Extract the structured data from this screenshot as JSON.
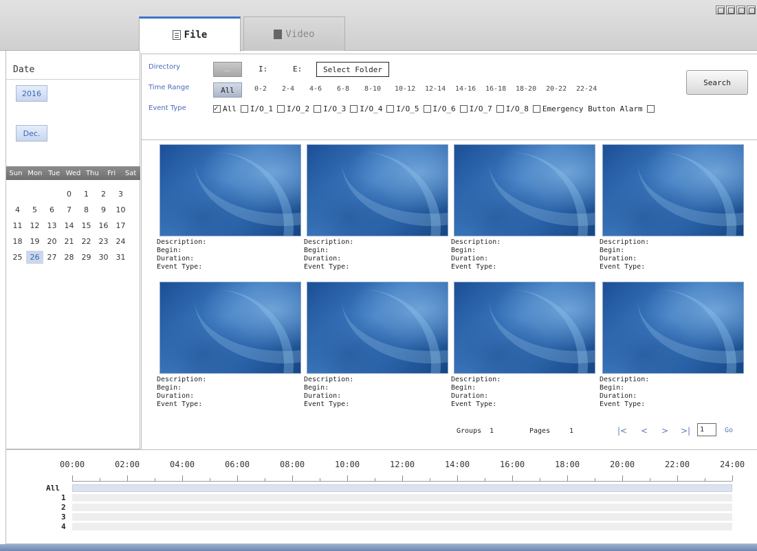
{
  "tabs": [
    {
      "label": "File",
      "icon": "file-icon",
      "active": true
    },
    {
      "label": "Video",
      "icon": "video-icon",
      "active": false
    }
  ],
  "window_buttons": [
    "restore-icon",
    "minimize-icon",
    "maximize-icon",
    "close-icon"
  ],
  "date_panel": {
    "label": "Date",
    "year": "2016",
    "month": "Dec.",
    "weekdays": [
      "Sun",
      "Mon",
      "Tue",
      "Wed",
      "Thu",
      "Fri",
      "Sat"
    ],
    "days": [
      "",
      "",
      "",
      "0",
      "1",
      "2",
      "3",
      "4",
      "5",
      "6",
      "7",
      "8",
      "9",
      "10",
      "11",
      "12",
      "13",
      "14",
      "15",
      "16",
      "17",
      "18",
      "19",
      "20",
      "21",
      "22",
      "23",
      "24",
      "25",
      "26",
      "27",
      "28",
      "29",
      "30",
      "31"
    ],
    "selected_day": "26",
    "accent_color": "#3a66b5"
  },
  "search_panel": {
    "directory_label": "Directory",
    "time_range_label": "Time Range",
    "event_type_label": "Event Type",
    "directory_button": "...",
    "drives": [
      "I:",
      "E:"
    ],
    "select_folder": "Select Folder",
    "all_button": "All",
    "time_ranges": [
      "0-2",
      "2-4",
      "4-6",
      "6-8",
      "8-10",
      "10-12",
      "12-14",
      "14-16",
      "16-18",
      "18-20",
      "20-22",
      "22-24"
    ],
    "event_types": [
      {
        "label": "All",
        "checked": true
      },
      {
        "label": "I/O_1",
        "checked": false
      },
      {
        "label": "I/O_2",
        "checked": false
      },
      {
        "label": "I/O_3",
        "checked": false
      },
      {
        "label": "I/O_4",
        "checked": false
      },
      {
        "label": "I/O_5",
        "checked": false
      },
      {
        "label": "I/O_6",
        "checked": false
      },
      {
        "label": "I/O_7",
        "checked": false
      },
      {
        "label": "I/O_8",
        "checked": false
      },
      {
        "label": "Emergency Button Alarm",
        "checked": false
      }
    ],
    "search_button": "Search"
  },
  "results": {
    "meta_labels": [
      "Description:",
      "Begin:",
      "Duration:",
      "Event Type:"
    ]
  },
  "pager": {
    "groups_label": "Groups",
    "groups_value": "1",
    "pages_label": "Pages",
    "pages_value": "1",
    "page_input": "1",
    "go_label": "Go"
  },
  "timeline": {
    "hours": [
      "00:00",
      "02:00",
      "04:00",
      "06:00",
      "08:00",
      "10:00",
      "12:00",
      "14:00",
      "16:00",
      "18:00",
      "20:00",
      "22:00",
      "24:00"
    ],
    "tracks": [
      "All",
      "1",
      "2",
      "3",
      "4"
    ]
  }
}
